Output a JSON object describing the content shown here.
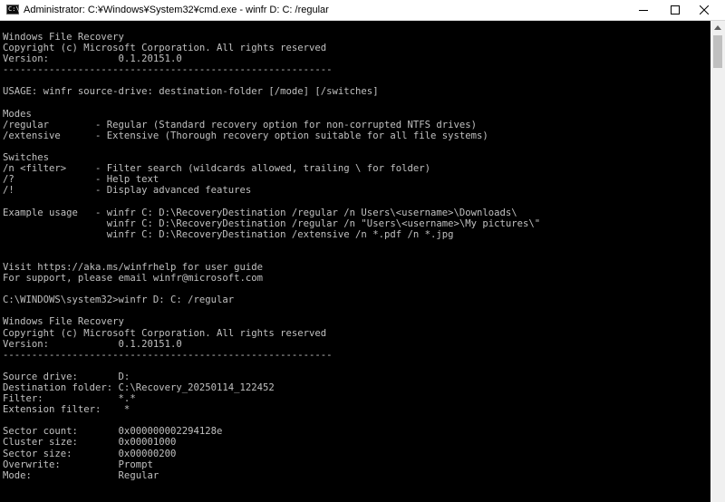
{
  "window": {
    "title": "Administrator: C:¥Windows¥System32¥cmd.exe - winfr  D: C: /regular",
    "icon_label": "C:\\",
    "icon": "console-app-icon",
    "buttons": [
      "minimize-icon",
      "maximize-icon",
      "close-icon"
    ]
  },
  "console": {
    "lines": [
      "Windows File Recovery",
      "Copyright (c) Microsoft Corporation. All rights reserved",
      "Version:            0.1.20151.0",
      "---------------------------------------------------------",
      "",
      "USAGE: winfr source-drive: destination-folder [/mode] [/switches]",
      "",
      "Modes",
      "/regular        - Regular (Standard recovery option for non-corrupted NTFS drives)",
      "/extensive      - Extensive (Thorough recovery option suitable for all file systems)",
      "",
      "Switches",
      "/n <filter>     - Filter search (wildcards allowed, trailing \\ for folder)",
      "/?              - Help text",
      "/!              - Display advanced features",
      "",
      "Example usage   - winfr C: D:\\RecoveryDestination /regular /n Users\\<username>\\Downloads\\",
      "                  winfr C: D:\\RecoveryDestination /regular /n \"Users\\<username>\\My pictures\\\"",
      "                  winfr C: D:\\RecoveryDestination /extensive /n *.pdf /n *.jpg",
      "",
      "",
      "Visit https://aka.ms/winfrhelp for user guide",
      "For support, please email winfr@microsoft.com",
      "",
      "C:\\WINDOWS\\system32>winfr D: C: /regular",
      "",
      "Windows File Recovery",
      "Copyright (c) Microsoft Corporation. All rights reserved",
      "Version:            0.1.20151.0",
      "---------------------------------------------------------",
      "",
      "Source drive:       D:",
      "Destination folder: C:\\Recovery_20250114_122452",
      "Filter:             *.*",
      "Extension filter:    *",
      "",
      "Sector count:       0x000000002294128e",
      "Cluster size:       0x00001000",
      "Sector size:        0x00000200",
      "Overwrite:          Prompt",
      "Mode:               Regular"
    ]
  }
}
